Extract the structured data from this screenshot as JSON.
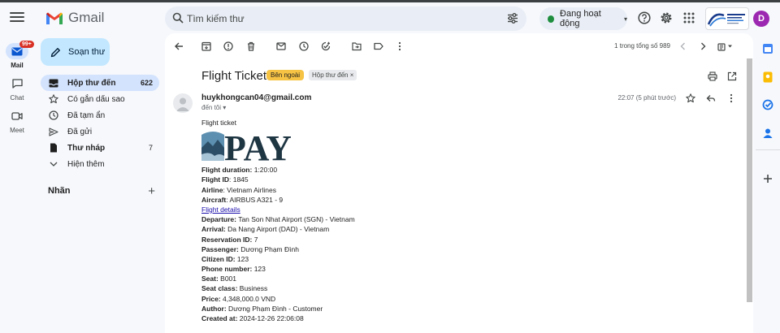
{
  "app": {
    "name": "Gmail"
  },
  "search": {
    "placeholder": "Tìm kiếm thư"
  },
  "status": {
    "label": "Đang hoạt động"
  },
  "avatar": {
    "initial": "D"
  },
  "rail": [
    {
      "label": "Mail",
      "badge": "99+"
    },
    {
      "label": "Chat"
    },
    {
      "label": "Meet"
    }
  ],
  "compose": {
    "label": "Soạn thư"
  },
  "nav": [
    {
      "label": "Hộp thư đến",
      "count": "622"
    },
    {
      "label": "Có gắn dấu sao",
      "count": ""
    },
    {
      "label": "Đã tạm ẩn",
      "count": ""
    },
    {
      "label": "Đã gửi",
      "count": ""
    },
    {
      "label": "Thư nháp",
      "count": "7"
    },
    {
      "label": "Hiện thêm",
      "count": ""
    }
  ],
  "labels": {
    "title": "Nhãn"
  },
  "pager": {
    "text": "1 trong tổng số 989"
  },
  "email": {
    "subject": "Flight Ticket",
    "tag_external": "Bên ngoài",
    "tag_inbox": "Hộp thư đến",
    "sender": "huykhongcan04@gmail.com",
    "to": "đến tôi",
    "time": "22:07 (5 phút trước)",
    "intro": "Flight ticket",
    "logo_text": "PAY",
    "fields": [
      {
        "label": "Flight duration:",
        "value": " 1:20:00"
      },
      {
        "label": "Flight ID",
        "value": ": 1845"
      },
      {
        "label": "Airline",
        "value": ": Vietnam Airlines"
      },
      {
        "label": "Aircraft",
        "value": ": AIRBUS A321 - 9"
      },
      {
        "link": "Flight details"
      },
      {
        "label": "Departure:",
        "value": " Tan Son Nhat Airport (SGN) - Vietnam"
      },
      {
        "label": "Arrival:",
        "value": " Da Nang Airport (DAD) - Vietnam"
      },
      {
        "label": "Reservation ID:",
        "value": " 7"
      },
      {
        "label": "Passenger:",
        "value": " Dương Phạm Đình"
      },
      {
        "label": "Citizen ID:",
        "value": " 123"
      },
      {
        "label": "Phone number:",
        "value": " 123"
      },
      {
        "label": "Seat:",
        "value": " B001"
      },
      {
        "label": "Seat class:",
        "value": " Business"
      },
      {
        "label": "Price:",
        "value": " 4,348,000.0 VND"
      },
      {
        "label": "Author:",
        "value": " Dương Phạm Đình - Customer"
      },
      {
        "label": "Created at:",
        "value": " 2024-12-26 22:06:08"
      }
    ]
  },
  "colors": {
    "accent": "#0b57d0",
    "nav_active": "#d3e3fd",
    "compose": "#c2e7ff",
    "status_green": "#1e8e3e",
    "tag_external": "#f6c344",
    "avatar": "#9c27b0",
    "logo_dark": "#1e3542"
  }
}
